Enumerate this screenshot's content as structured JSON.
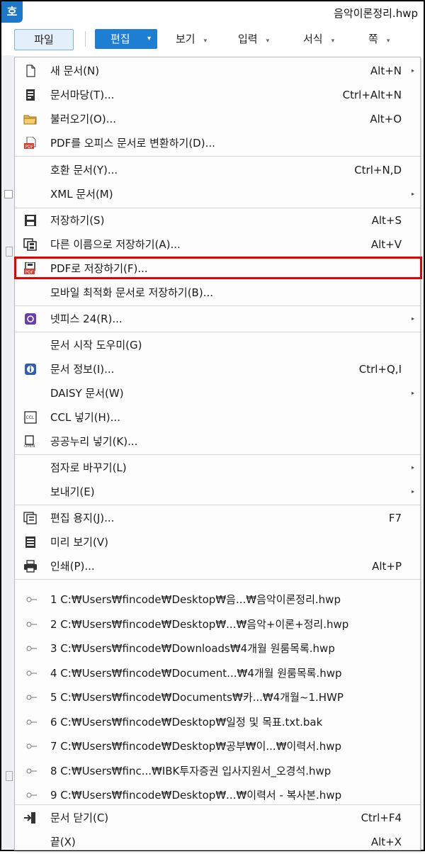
{
  "app": {
    "logo": "호",
    "doc_title": "음악이론정리.hwp"
  },
  "menubar": {
    "file": "파일",
    "edit": "편집",
    "caret": "▾",
    "tabs": [
      {
        "label": "보기"
      },
      {
        "label": "입력"
      },
      {
        "label": "서식"
      },
      {
        "label": "쪽"
      }
    ]
  },
  "menu": {
    "items": [
      {
        "label": "새 문서(N)",
        "shortcut": "Alt+N",
        "submenu": true,
        "icon": "new-document-icon"
      },
      {
        "label": "문서마당(T)...",
        "shortcut": "Ctrl+Alt+N",
        "icon": "template-icon"
      },
      {
        "label": "불러오기(O)...",
        "shortcut": "Alt+O",
        "icon": "open-folder-icon"
      },
      {
        "label": "PDF를 오피스 문서로 변환하기(D)...",
        "shortcut": "",
        "icon": "pdf-convert-icon"
      },
      {
        "label": "호환 문서(Y)...",
        "shortcut": "Ctrl+N,D"
      },
      {
        "label": "XML 문서(M)",
        "shortcut": "",
        "submenu": true
      },
      {
        "label": "저장하기(S)",
        "shortcut": "Alt+S",
        "icon": "save-icon"
      },
      {
        "label": "다른 이름으로 저장하기(A)...",
        "shortcut": "Alt+V",
        "icon": "save-as-icon"
      },
      {
        "label": "PDF로 저장하기(F)...",
        "shortcut": "",
        "icon": "save-pdf-icon"
      },
      {
        "label": "모바일 최적화 문서로 저장하기(B)...",
        "shortcut": ""
      },
      {
        "label": "넷피스 24(R)...",
        "shortcut": "",
        "submenu": true,
        "icon": "netffice-icon"
      },
      {
        "label": "문서 시작 도우미(G)",
        "shortcut": ""
      },
      {
        "label": "문서 정보(I)...",
        "shortcut": "Ctrl+Q,I",
        "icon": "info-icon"
      },
      {
        "label": "DAISY 문서(W)",
        "shortcut": "",
        "submenu": true
      },
      {
        "label": "CCL 넣기(H)...",
        "shortcut": "",
        "icon": "ccl-icon"
      },
      {
        "label": "공공누리 넣기(K)...",
        "shortcut": "",
        "icon": "open-license-icon"
      },
      {
        "label": "점자로 바꾸기(L)",
        "shortcut": "",
        "submenu": true
      },
      {
        "label": "보내기(E)",
        "shortcut": "",
        "submenu": true
      },
      {
        "label": "편집 용지(J)...",
        "shortcut": "F7",
        "icon": "page-setup-icon"
      },
      {
        "label": "미리 보기(V)",
        "shortcut": "",
        "icon": "preview-icon"
      },
      {
        "label": "인쇄(P)...",
        "shortcut": "Alt+P",
        "icon": "print-icon"
      }
    ],
    "recent": [
      "1 C:₩Users₩fincode₩Desktop₩음...₩음악이론정리.hwp",
      "2 C:₩Users₩fincode₩Desktop₩...₩음악+이론+정리.hwp",
      "3 C:₩Users₩fincode₩Downloads₩4개월 원룸목록.hwp",
      "4 C:₩Users₩fincode₩Document...₩4개월 원룸목록.hwp",
      "5 C:₩Users₩fincode₩Documents₩카...₩4개월~1.HWP",
      "6 C:₩Users₩fincode₩Desktop₩일정 및 목표.txt.bak",
      "7 C:₩Users₩fincode₩Desktop₩공부₩이...₩이력서.hwp",
      "8 C:₩Users₩finc...₩IBK투자증권 입사지원서_오경석.hwp",
      "9 C:₩Users₩fincode₩Desktop₩...₩이력서 - 복사본.hwp"
    ],
    "close": {
      "label": "문서 닫기(C)",
      "shortcut": "Ctrl+F4",
      "icon": "close-document-icon"
    },
    "exit": {
      "label": "끝(X)",
      "shortcut": "Alt+X"
    },
    "submenu_arrow": "▸",
    "highlight_color": "#e60000"
  }
}
